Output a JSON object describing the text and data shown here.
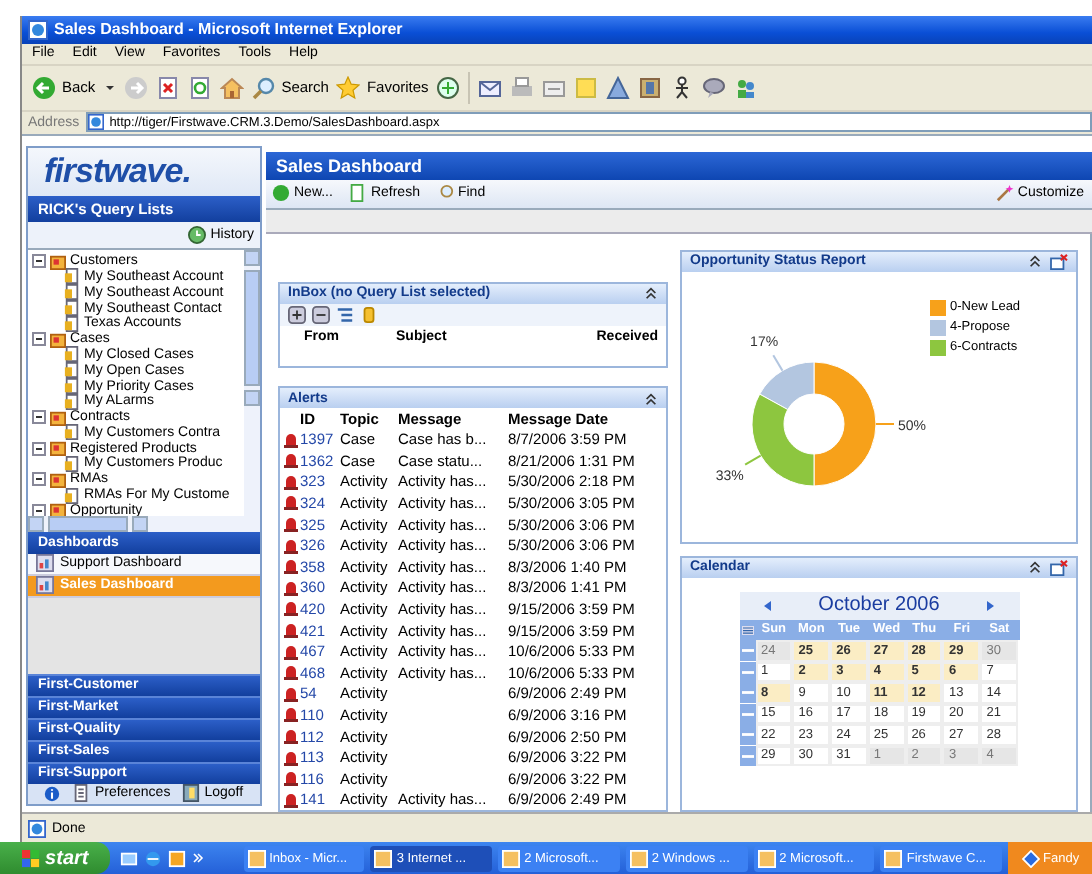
{
  "window": {
    "title": "Sales Dashboard - Microsoft Internet Explorer"
  },
  "menu": [
    "File",
    "Edit",
    "View",
    "Favorites",
    "Tools",
    "Help"
  ],
  "toolbar": {
    "back": "Back",
    "search": "Search",
    "favorites": "Favorites"
  },
  "address": {
    "label": "Address",
    "url": "http://tiger/Firstwave.CRM.3.Demo/SalesDashboard.aspx"
  },
  "sidebar": {
    "logo": "firstwave.",
    "query_title": "RICK's Query Lists",
    "history": "History",
    "tree": [
      {
        "label": "Customers",
        "expanded": true,
        "children": [
          {
            "label": "My Southeast Account"
          },
          {
            "label": "My Southeast Account"
          },
          {
            "label": "My Southeast Contact"
          },
          {
            "label": "Texas Accounts"
          }
        ]
      },
      {
        "label": "Cases",
        "expanded": true,
        "children": [
          {
            "label": "My Closed Cases"
          },
          {
            "label": "My Open Cases"
          },
          {
            "label": "My Priority Cases"
          },
          {
            "label": "My ALarms"
          }
        ]
      },
      {
        "label": "Contracts",
        "expanded": true,
        "children": [
          {
            "label": "My Customers Contra"
          }
        ]
      },
      {
        "label": "Registered Products",
        "expanded": true,
        "children": [
          {
            "label": "My Customers Produc"
          }
        ]
      },
      {
        "label": "RMAs",
        "expanded": true,
        "children": [
          {
            "label": "RMAs For My Custome"
          }
        ]
      },
      {
        "label": "Opportunity",
        "expanded": true
      }
    ],
    "dashboards_title": "Dashboards",
    "dashboards": [
      {
        "label": "Support Dashboard",
        "selected": false
      },
      {
        "label": "Sales Dashboard",
        "selected": true
      }
    ],
    "modules": [
      "First-Customer",
      "First-Market",
      "First-Quality",
      "First-Sales",
      "First-Support"
    ],
    "preferences": "Preferences",
    "logoff": "Logoff"
  },
  "page": {
    "title": "Sales Dashboard",
    "actions": [
      "New...",
      "Refresh",
      "Find"
    ],
    "customize": "Customize"
  },
  "inbox": {
    "title": "InBox (no Query List selected)",
    "columns": [
      "From",
      "Subject",
      "Received"
    ]
  },
  "alerts": {
    "title": "Alerts",
    "columns": [
      "ID",
      "Topic",
      "Message",
      "Message Date"
    ],
    "rows": [
      {
        "id": "1397",
        "topic": "Case",
        "message": "Case has b...",
        "date": "8/7/2006 3:59 PM"
      },
      {
        "id": "1362",
        "topic": "Case",
        "message": "Case statu...",
        "date": "8/21/2006 1:31 PM"
      },
      {
        "id": "323",
        "topic": "Activity",
        "message": "Activity has...",
        "date": "5/30/2006 2:18 PM"
      },
      {
        "id": "324",
        "topic": "Activity",
        "message": "Activity has...",
        "date": "5/30/2006 3:05 PM"
      },
      {
        "id": "325",
        "topic": "Activity",
        "message": "Activity has...",
        "date": "5/30/2006 3:06 PM"
      },
      {
        "id": "326",
        "topic": "Activity",
        "message": "Activity has...",
        "date": "5/30/2006 3:06 PM"
      },
      {
        "id": "358",
        "topic": "Activity",
        "message": "Activity has...",
        "date": "8/3/2006 1:40 PM"
      },
      {
        "id": "360",
        "topic": "Activity",
        "message": "Activity has...",
        "date": "8/3/2006 1:41 PM"
      },
      {
        "id": "420",
        "topic": "Activity",
        "message": "Activity has...",
        "date": "9/15/2006 3:59 PM"
      },
      {
        "id": "421",
        "topic": "Activity",
        "message": "Activity has...",
        "date": "9/15/2006 3:59 PM"
      },
      {
        "id": "467",
        "topic": "Activity",
        "message": "Activity has...",
        "date": "10/6/2006 5:33 PM"
      },
      {
        "id": "468",
        "topic": "Activity",
        "message": "Activity has...",
        "date": "10/6/2006 5:33 PM"
      },
      {
        "id": "54",
        "topic": "Activity",
        "date": "6/9/2006 2:49 PM"
      },
      {
        "id": "110",
        "topic": "Activity",
        "date": "6/9/2006 3:16 PM"
      },
      {
        "id": "112",
        "topic": "Activity",
        "date": "6/9/2006 2:50 PM"
      },
      {
        "id": "113",
        "topic": "Activity",
        "date": "6/9/2006 3:22 PM"
      },
      {
        "id": "116",
        "topic": "Activity",
        "date": "6/9/2006 3:22 PM"
      },
      {
        "id": "141",
        "topic": "Activity",
        "message": "Activity has...",
        "date": "6/9/2006 2:49 PM"
      }
    ]
  },
  "opportunity": {
    "title": "Opportunity Status Report",
    "chart_data": {
      "type": "donut",
      "categories": [
        "0-New Lead",
        "4-Propose",
        "6-Contracts"
      ],
      "values": [
        50,
        17,
        33
      ],
      "colors": [
        "#f7a11a",
        "#b3c6e0",
        "#8dc63f"
      ],
      "value_labels": [
        "50%",
        "17%",
        "33%"
      ],
      "legend": "right"
    }
  },
  "calendar": {
    "title": "Calendar",
    "month": "October 2006",
    "weekdays": [
      "Sun",
      "Mon",
      "Tue",
      "Wed",
      "Thu",
      "Fri",
      "Sat"
    ],
    "weeks": [
      [
        {
          "label": "24",
          "other_month": true,
          "has_items": false
        },
        {
          "label": "25",
          "other_month": false,
          "has_items": true
        },
        {
          "label": "26",
          "other_month": false,
          "has_items": true
        },
        {
          "label": "27",
          "other_month": false,
          "has_items": true
        },
        {
          "label": "28",
          "other_month": false,
          "has_items": true
        },
        {
          "label": "29",
          "other_month": false,
          "has_items": true
        },
        {
          "label": "30",
          "other_month": true,
          "has_items": false
        }
      ],
      [
        {
          "label": "1",
          "other_month": false,
          "has_items": false
        },
        {
          "label": "2",
          "other_month": false,
          "has_items": true
        },
        {
          "label": "3",
          "other_month": false,
          "has_items": true
        },
        {
          "label": "4",
          "other_month": false,
          "has_items": true
        },
        {
          "label": "5",
          "other_month": false,
          "has_items": true
        },
        {
          "label": "6",
          "other_month": false,
          "has_items": true
        },
        {
          "label": "7",
          "other_month": false,
          "has_items": false
        }
      ],
      [
        {
          "label": "8",
          "other_month": false,
          "has_items": true
        },
        {
          "label": "9",
          "other_month": false,
          "has_items": false
        },
        {
          "label": "10",
          "other_month": false,
          "has_items": false
        },
        {
          "label": "11",
          "other_month": false,
          "has_items": true
        },
        {
          "label": "12",
          "other_month": false,
          "has_items": true
        },
        {
          "label": "13",
          "other_month": false,
          "has_items": false
        },
        {
          "label": "14",
          "other_month": false,
          "has_items": false
        }
      ],
      [
        {
          "label": "15",
          "other_month": false,
          "has_items": false
        },
        {
          "label": "16",
          "other_month": false,
          "has_items": false
        },
        {
          "label": "17",
          "other_month": false,
          "has_items": false
        },
        {
          "label": "18",
          "other_month": false,
          "has_items": false
        },
        {
          "label": "19",
          "other_month": false,
          "has_items": false
        },
        {
          "label": "20",
          "other_month": false,
          "has_items": false
        },
        {
          "label": "21",
          "other_month": false,
          "has_items": false
        }
      ],
      [
        {
          "label": "22",
          "other_month": false,
          "has_items": false
        },
        {
          "label": "23",
          "other_month": false,
          "has_items": false
        },
        {
          "label": "24",
          "other_month": false,
          "has_items": false
        },
        {
          "label": "25",
          "other_month": false,
          "has_items": false
        },
        {
          "label": "26",
          "other_month": false,
          "has_items": false
        },
        {
          "label": "27",
          "other_month": false,
          "has_items": false
        },
        {
          "label": "28",
          "other_month": false,
          "has_items": false
        }
      ],
      [
        {
          "label": "29",
          "other_month": false,
          "has_items": false
        },
        {
          "label": "30",
          "other_month": false,
          "has_items": false
        },
        {
          "label": "31",
          "other_month": false,
          "has_items": false
        },
        {
          "label": "1",
          "other_month": true,
          "has_items": false
        },
        {
          "label": "2",
          "other_month": true,
          "has_items": false
        },
        {
          "label": "3",
          "other_month": true,
          "has_items": false
        },
        {
          "label": "4",
          "other_month": true,
          "has_items": false
        }
      ]
    ]
  },
  "status_bar": {
    "text": "Done"
  },
  "taskbar": {
    "start": "start",
    "items": [
      {
        "label": "Inbox - Micr...",
        "selected": false
      },
      {
        "label": "3 Internet ...",
        "selected": true
      },
      {
        "label": "2 Microsoft...",
        "selected": false
      },
      {
        "label": "2 Windows ...",
        "selected": false
      },
      {
        "label": "2 Microsoft...",
        "selected": false
      },
      {
        "label": "Firstwave C...",
        "selected": false
      }
    ],
    "tray": "Fandy"
  }
}
